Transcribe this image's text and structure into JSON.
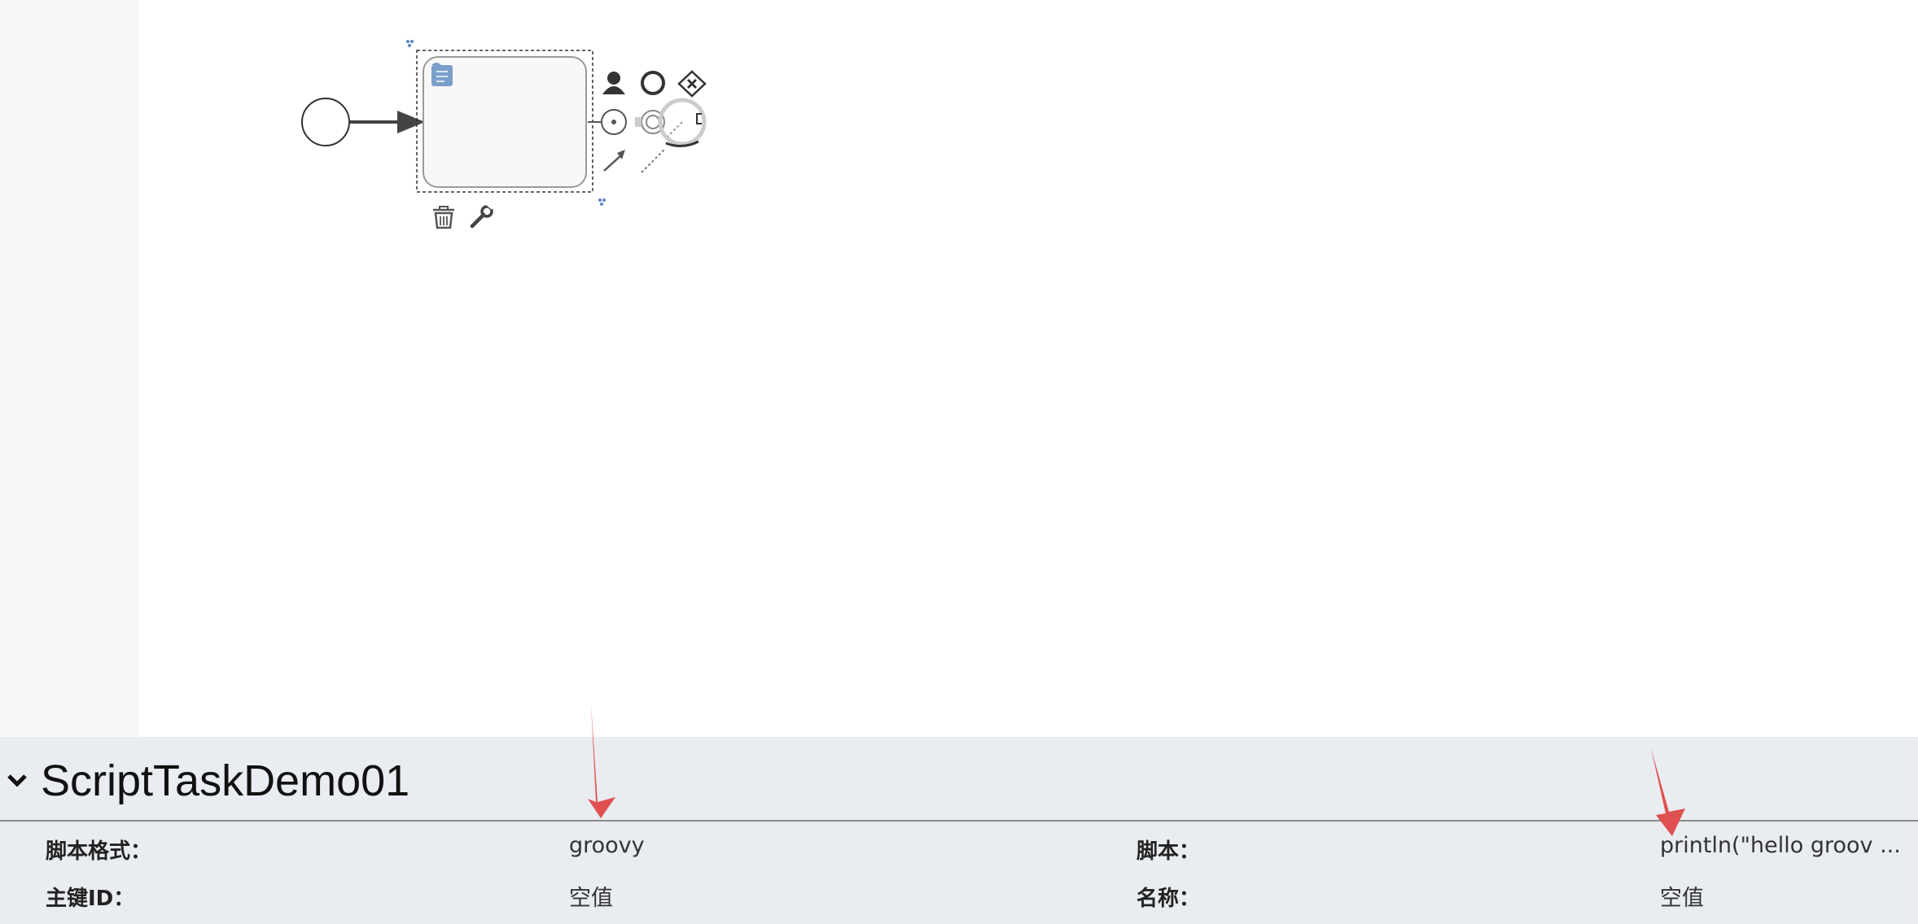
{
  "diagram": {
    "elements": [
      {
        "name": "start-event",
        "type": "start-event"
      },
      {
        "name": "sequence-flow",
        "type": "sequence-flow"
      },
      {
        "name": "script-task",
        "type": "script-task",
        "icon": "script-icon",
        "selected": true
      }
    ],
    "context_pad": [
      "append-user-task-icon",
      "append-end-event-icon",
      "append-exclusive-gateway-icon",
      "append-intermediate-event-icon",
      "append-intermediate-throw-event-icon",
      "append-text-annotation-icon",
      "connect-arrow-icon",
      "connect-association-icon",
      "delete-trash-icon",
      "change-type-wrench-icon"
    ],
    "colors": {
      "task_icon": "#7b9fcb",
      "task_fill": "#f8f8f8",
      "annotation_arrow": "#e05050"
    }
  },
  "properties": {
    "collapsed": false,
    "title": "ScriptTaskDemo01",
    "fields": [
      {
        "label": "脚本格式：",
        "value": "groovy"
      },
      {
        "label": "脚本：",
        "value": "println(\"hello groov ..."
      },
      {
        "label": "主键ID：",
        "value": "空值"
      },
      {
        "label": "名称：",
        "value": "空值"
      }
    ]
  }
}
